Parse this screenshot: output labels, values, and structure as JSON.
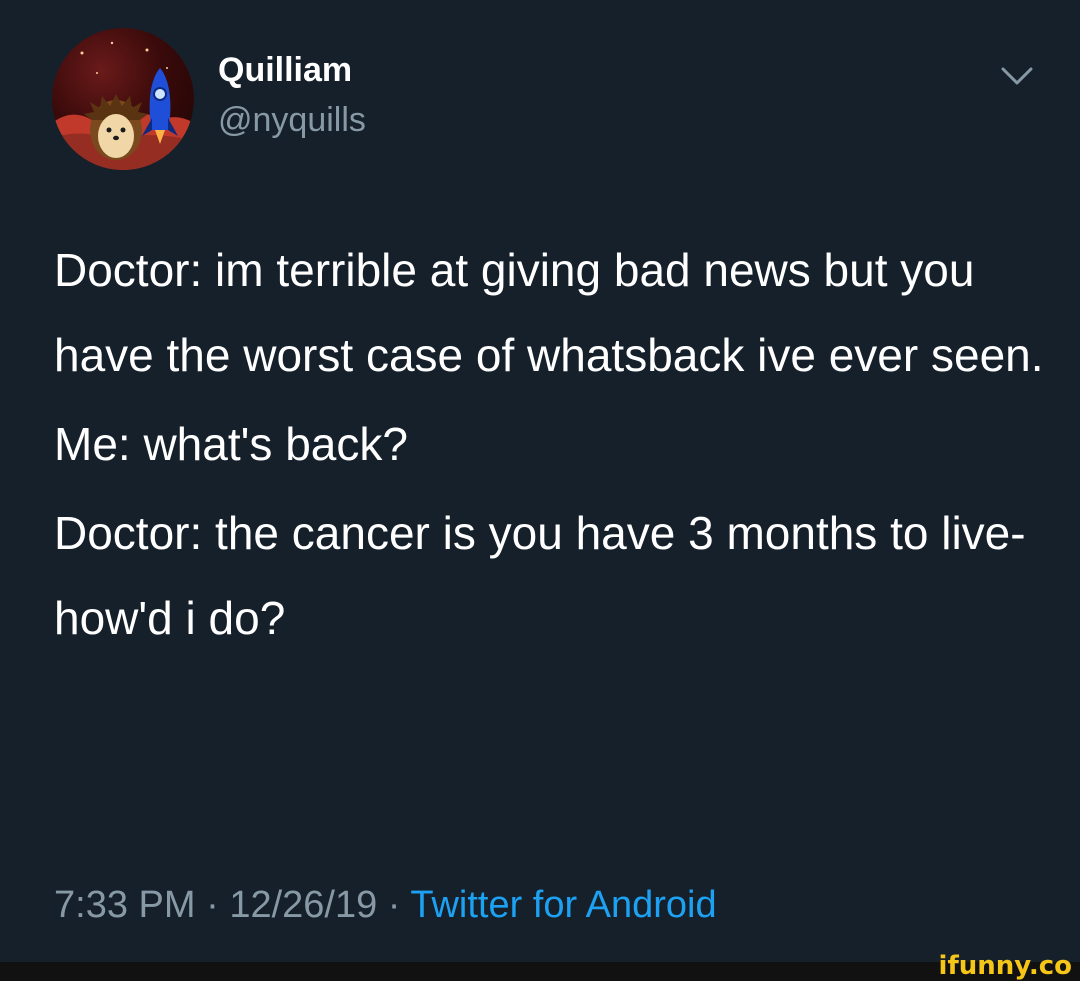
{
  "colors": {
    "background": "#15202b",
    "primary_text": "#ffffff",
    "secondary_text": "#8899a6",
    "link": "#1da1f2",
    "watermark": "#f5c518"
  },
  "header": {
    "avatar_icon": "avatar-hedgehog-rocket",
    "display_name": "Quilliam",
    "handle": "@nyquills",
    "menu_icon": "chevron-down-icon"
  },
  "tweet": {
    "paragraphs": [
      "Doctor: im terrible at giving bad news but you have the worst case of whatsback ive ever seen.",
      "Me: what's back?",
      "Doctor: the cancer is you have 3 months to live- how'd i do?"
    ]
  },
  "meta": {
    "time": "7:33 PM",
    "separator1": " · ",
    "date": "12/26/19",
    "separator2": " · ",
    "source": "Twitter for Android"
  },
  "watermark": {
    "text": "ifunny.co"
  }
}
